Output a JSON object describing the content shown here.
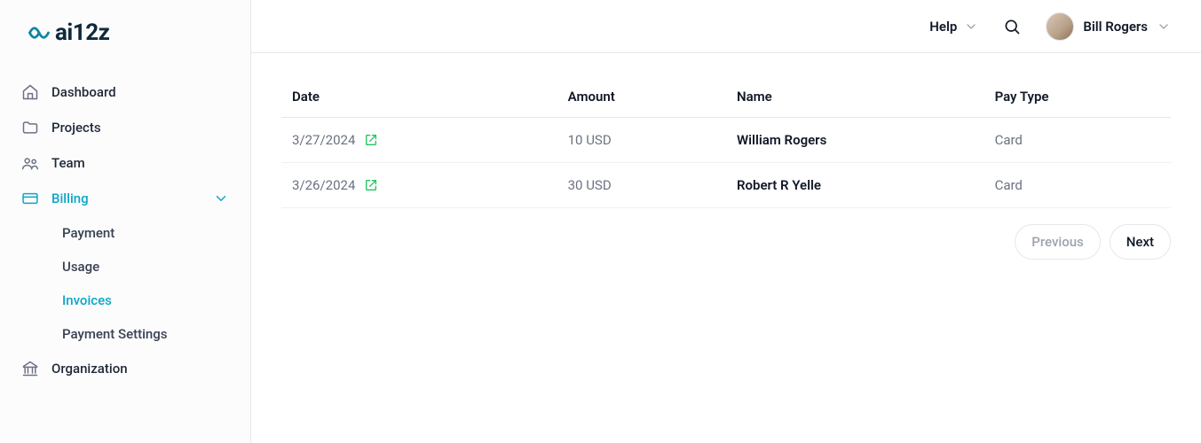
{
  "brand": {
    "text": "ai12z"
  },
  "sidebar": {
    "items": [
      {
        "label": "Dashboard",
        "icon": "home"
      },
      {
        "label": "Projects",
        "icon": "folder"
      },
      {
        "label": "Team",
        "icon": "users"
      },
      {
        "label": "Billing",
        "icon": "card",
        "active": true,
        "expanded": true
      },
      {
        "label": "Organization",
        "icon": "bank"
      }
    ],
    "billing_sub": [
      {
        "label": "Payment"
      },
      {
        "label": "Usage"
      },
      {
        "label": "Invoices",
        "active": true
      },
      {
        "label": "Payment Settings"
      }
    ]
  },
  "topbar": {
    "help_label": "Help",
    "user_name": "Bill Rogers"
  },
  "invoices": {
    "columns": {
      "date": "Date",
      "amount": "Amount",
      "name": "Name",
      "pay_type": "Pay Type"
    },
    "rows": [
      {
        "date": "3/27/2024",
        "amount": "10 USD",
        "name": "William Rogers",
        "pay_type": "Card"
      },
      {
        "date": "3/26/2024",
        "amount": "30 USD",
        "name": "Robert R Yelle",
        "pay_type": "Card"
      }
    ]
  },
  "pager": {
    "prev": "Previous",
    "next": "Next"
  }
}
